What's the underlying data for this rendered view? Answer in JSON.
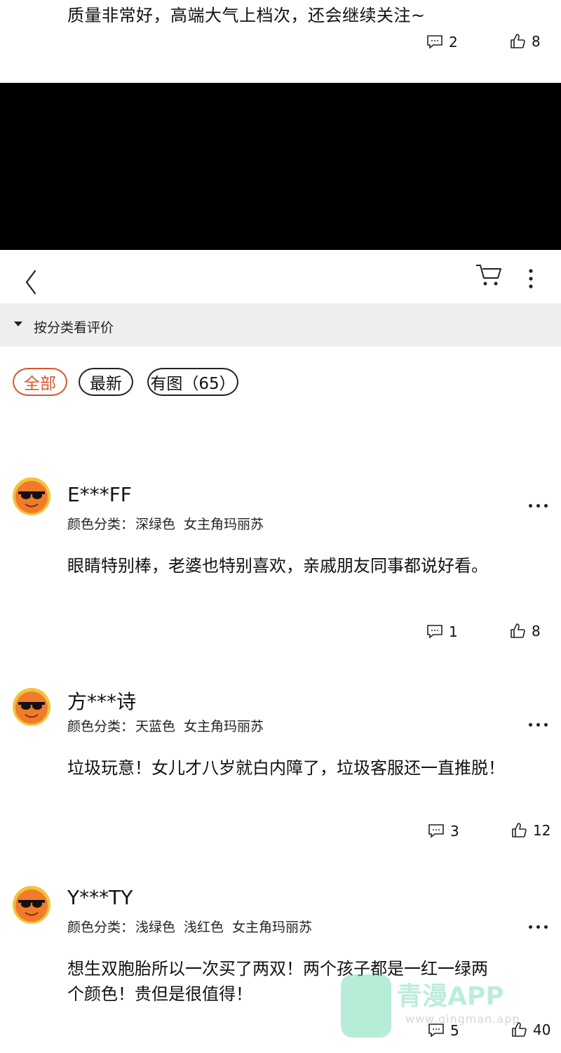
{
  "top_review": {
    "text": "质量非常好，高端大气上档次，还会继续关注~",
    "comment_count": "2",
    "like_count": "8"
  },
  "category_filter": {
    "label": "按分类看评价"
  },
  "filters": [
    {
      "label": "全部",
      "active": true
    },
    {
      "label": "最新",
      "active": false
    },
    {
      "label": "有图（65）",
      "active": false
    }
  ],
  "reviews": [
    {
      "username": "E***FF",
      "spec_label": "颜色分类：",
      "spec_values": [
        "深绿色",
        "女主角玛丽苏"
      ],
      "text": "眼睛特别棒，老婆也特别喜欢，亲戚朋友同事都说好看。",
      "comment_count": "1",
      "like_count": "8"
    },
    {
      "username": "方***诗",
      "spec_label": "颜色分类：",
      "spec_values": [
        "天蓝色",
        "女主角玛丽苏"
      ],
      "text": "垃圾玩意！女儿才八岁就白内障了，垃圾客服还一直推脱！",
      "comment_count": "3",
      "like_count": "12"
    },
    {
      "username": "Y***TY",
      "spec_label": "颜色分类：",
      "spec_values": [
        "浅绿色",
        "浅红色",
        "女主角玛丽苏"
      ],
      "text": "想生双胞胎所以一次买了两双！两个孩子都是一红一绿两个颜色！贵但是很值得！",
      "comment_count": "5",
      "like_count": "40"
    }
  ],
  "watermark": {
    "name": "青漫APP",
    "url": "www.qingman.app"
  },
  "colors": {
    "accent": "#d8562f",
    "category_bar_bg": "#eeeeee",
    "avatar": "#f07b2a"
  },
  "icons": [
    "comment-icon",
    "thumbs-up-icon",
    "back-arrow-icon",
    "cart-icon",
    "more-vertical-icon",
    "more-horizontal-icon",
    "triangle-down-icon"
  ]
}
